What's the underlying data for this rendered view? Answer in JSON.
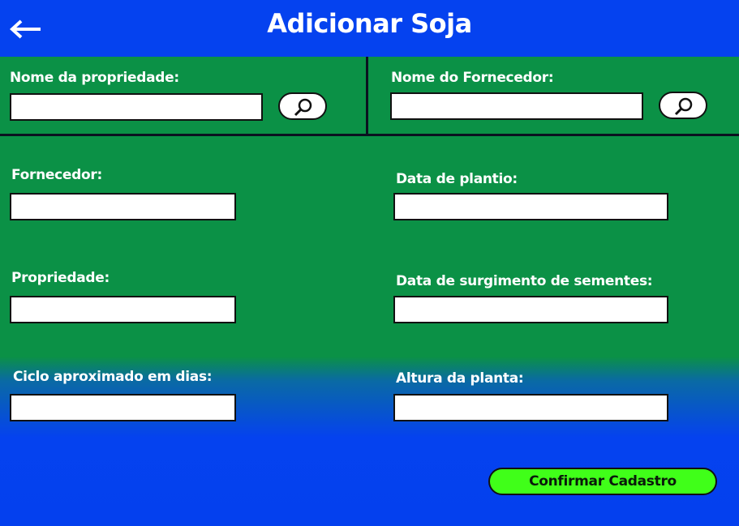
{
  "header": {
    "title": "Adicionar Soja",
    "back_icon": "arrow-left-icon"
  },
  "search": {
    "propriedade": {
      "label": "Nome da propriedade:",
      "value": "",
      "icon": "magnifier-icon"
    },
    "fornecedor": {
      "label": "Nome do Fornecedor:",
      "value": "",
      "icon": "magnifier-icon"
    }
  },
  "form": {
    "fornecedor": {
      "label": "Fornecedor:",
      "value": ""
    },
    "data_plantio": {
      "label": "Data de plantio:",
      "value": ""
    },
    "propriedade": {
      "label": "Propriedade:",
      "value": ""
    },
    "data_sementes": {
      "label": "Data de surgimento de sementes:",
      "value": ""
    },
    "ciclo": {
      "label": "Ciclo aproximado em dias:",
      "value": ""
    },
    "altura": {
      "label": "Altura da planta:",
      "value": ""
    }
  },
  "actions": {
    "confirm_label": "Confirmar Cadastro"
  },
  "colors": {
    "header_blue": "#0542ef",
    "panel_green": "#0b9146",
    "confirm_green": "#40ff19"
  }
}
